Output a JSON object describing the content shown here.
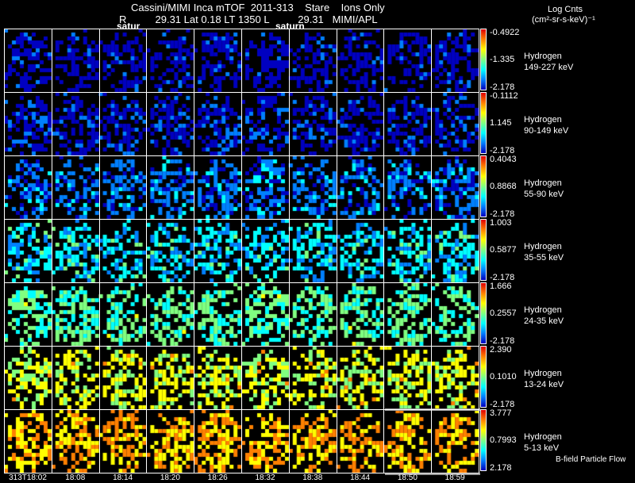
{
  "header": {
    "line1": "Cassini/MIMI Inca mTOF  2011-313    Stare    Ions Only",
    "line2": "R          29.31 Lat 0.18 LT 1350 L          29.31   MIMI/APL",
    "planet_label_1": "satur",
    "planet_label_2": "saturn"
  },
  "units": {
    "title": "Log Cnts",
    "subtitle": "(cm²-sr-s-keV)⁻¹"
  },
  "chart_data": {
    "type": "heatmap",
    "title": "Cassini/MIMI Inca mTOF 2011-313 Stare Ions Only",
    "times": [
      "313T18:02",
      "18:08",
      "18:14",
      "18:20",
      "18:26",
      "18:32",
      "18:38",
      "18:44",
      "18:50",
      "18:59"
    ],
    "rows": [
      {
        "species": "Hydrogen",
        "energy": "149-227 keV",
        "max": "-0.4922",
        "mid": "-1.335",
        "min": "-2.178"
      },
      {
        "species": "Hydrogen",
        "energy": "90-149 keV",
        "max": "-0.1112",
        "mid": "1.145",
        "min": "-2.178"
      },
      {
        "species": "Hydrogen",
        "energy": "55-90 keV",
        "max": "0.4043",
        "mid": "0.8868",
        "min": "-2.178"
      },
      {
        "species": "Hydrogen",
        "energy": "35-55 keV",
        "max": "1.003",
        "mid": "0.5877",
        "min": "-2.178"
      },
      {
        "species": "Hydrogen",
        "energy": "24-35 keV",
        "max": "1.666",
        "mid": "0.2557",
        "min": "-2.178"
      },
      {
        "species": "Hydrogen",
        "energy": "13-24 keV",
        "max": "2.390",
        "mid": "0.1010",
        "min": "-2.178"
      },
      {
        "species": "Hydrogen",
        "energy": "5-13 keV",
        "max": "3.777",
        "mid": "0.7993",
        "min": "2.178"
      }
    ],
    "colorscale": [
      "#0000c0",
      "#0080ff",
      "#00ffff",
      "#80ff80",
      "#ffff00",
      "#ff8000",
      "#e00000"
    ]
  },
  "legend": {
    "bfield": "B-field Particle Flow"
  }
}
